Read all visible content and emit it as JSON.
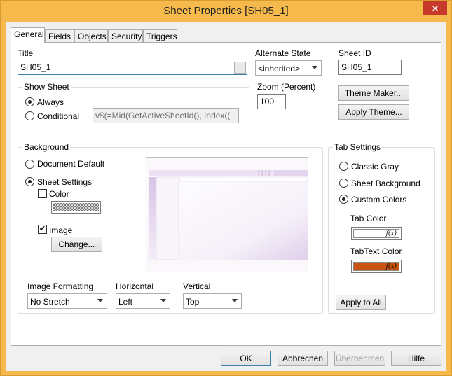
{
  "window": {
    "title": "Sheet Properties [SH05_1]",
    "close_glyph": "✕"
  },
  "tabs": [
    {
      "label": "General",
      "active": true
    },
    {
      "label": "Fields"
    },
    {
      "label": "Objects"
    },
    {
      "label": "Security"
    },
    {
      "label": "Triggers"
    }
  ],
  "general": {
    "title_label": "Title",
    "title_value": "SH05_1",
    "browse_label": "...",
    "alternate_state_label": "Alternate State",
    "alternate_state_value": "<inherited>",
    "sheet_id_label": "Sheet ID",
    "sheet_id_value": "SH05_1",
    "zoom_label": "Zoom (Percent)",
    "zoom_value": "100",
    "theme_maker_label": "Theme Maker...",
    "apply_theme_label": "Apply Theme...",
    "show_sheet": {
      "title": "Show Sheet",
      "always_label": "Always",
      "conditional_label": "Conditional",
      "conditional_expr": "v$(=Mid(GetActiveSheetId(), Index(("
    },
    "background": {
      "title": "Background",
      "document_default_label": "Document Default",
      "sheet_settings_label": "Sheet Settings",
      "color_label": "Color",
      "image_label": "Image",
      "change_label": "Change...",
      "image_formatting_label": "Image Formatting",
      "image_formatting_value": "No Stretch",
      "horizontal_label": "Horizontal",
      "horizontal_value": "Left",
      "vertical_label": "Vertical",
      "vertical_value": "Top"
    },
    "tab_settings": {
      "title": "Tab Settings",
      "classic_gray_label": "Classic Gray",
      "sheet_background_label": "Sheet Background",
      "custom_colors_label": "Custom Colors",
      "tab_color_label": "Tab Color",
      "tabtext_color_label": "TabText Color",
      "fx_label": "f(x)",
      "tab_color": "#ffffff",
      "tabtext_color": "#c8540f",
      "apply_to_all_label": "Apply to All"
    }
  },
  "footer": {
    "ok_label": "OK",
    "cancel_label": "Abbrechen",
    "apply_label": "Übernehmen",
    "help_label": "Hilfe"
  }
}
